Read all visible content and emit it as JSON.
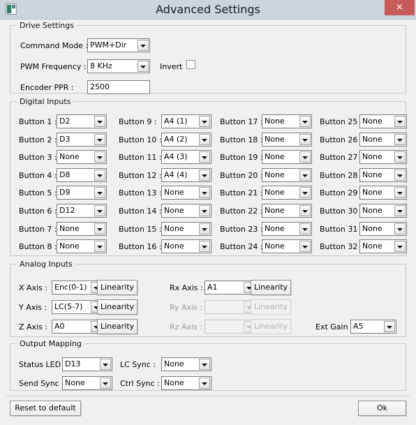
{
  "window": {
    "title": "Advanced Settings",
    "icon": "app-icon",
    "close_label": "×"
  },
  "drive_settings": {
    "legend": "Drive Settings",
    "fields": [
      {
        "label": "Command Mode :",
        "value": "PWM+Dir"
      },
      {
        "label": "PWM Frequency :",
        "value": "8 KHz"
      },
      {
        "label": "Encoder PPR :",
        "value": "2500"
      }
    ],
    "invert": {
      "label": "Invert",
      "checked": false
    }
  },
  "digital_inputs": {
    "legend": "Digital Inputs",
    "buttons": [
      {
        "label": "Button  1 :",
        "value": "D2"
      },
      {
        "label": "Button  2 :",
        "value": "D3"
      },
      {
        "label": "Button  3 :",
        "value": "None"
      },
      {
        "label": "Button  4 :",
        "value": "D8"
      },
      {
        "label": "Button  5 :",
        "value": "D9"
      },
      {
        "label": "Button  6 :",
        "value": "D12"
      },
      {
        "label": "Button  7 :",
        "value": "None"
      },
      {
        "label": "Button  8 :",
        "value": "None"
      },
      {
        "label": "Button  9 :",
        "value": "A4 (1)"
      },
      {
        "label": "Button 10 :",
        "value": "A4 (2)"
      },
      {
        "label": "Button 11 :",
        "value": "A4 (3)"
      },
      {
        "label": "Button 12 :",
        "value": "A4 (4)"
      },
      {
        "label": "Button 13 :",
        "value": "None"
      },
      {
        "label": "Button 14 :",
        "value": "None"
      },
      {
        "label": "Button 15 :",
        "value": "None"
      },
      {
        "label": "Button 16 :",
        "value": "None"
      },
      {
        "label": "Button 17 :",
        "value": "None"
      },
      {
        "label": "Button 18 :",
        "value": "None"
      },
      {
        "label": "Button 19 :",
        "value": "None"
      },
      {
        "label": "Button 20 :",
        "value": "None"
      },
      {
        "label": "Button 21 :",
        "value": "None"
      },
      {
        "label": "Button 22 :",
        "value": "None"
      },
      {
        "label": "Button 23 :",
        "value": "None"
      },
      {
        "label": "Button 24 :",
        "value": "None"
      },
      {
        "label": "Button 25 :",
        "value": "None"
      },
      {
        "label": "Button 26 :",
        "value": "None"
      },
      {
        "label": "Button 27 :",
        "value": "None"
      },
      {
        "label": "Button 28 :",
        "value": "None"
      },
      {
        "label": "Button 29 :",
        "value": "None"
      },
      {
        "label": "Button 30 :",
        "value": "None"
      },
      {
        "label": "Button 31 :",
        "value": "None"
      },
      {
        "label": "Button 32 :",
        "value": "None"
      }
    ]
  },
  "analog_inputs": {
    "legend": "Analog Inputs",
    "linearity_label": "Linearity",
    "left_axes": [
      {
        "label": "X Axis :",
        "value": "Enc(0-1)",
        "enabled": true
      },
      {
        "label": "Y Axis :",
        "value": "LC(5-7)",
        "enabled": true
      },
      {
        "label": "Z Axis :",
        "value": "A0",
        "enabled": true
      }
    ],
    "right_axes": [
      {
        "label": "Rx Axis :",
        "value": "A1",
        "enabled": true
      },
      {
        "label": "Ry Axis :",
        "value": "",
        "enabled": false
      },
      {
        "label": "Rz Axis :",
        "value": "",
        "enabled": false
      }
    ],
    "ext_gain": {
      "label": "Ext Gain :",
      "value": "A5"
    }
  },
  "output_mapping": {
    "legend": "Output Mapping",
    "fields": [
      {
        "label": "Status LED :",
        "value": "D13"
      },
      {
        "label": "Send Sync :",
        "value": "None"
      },
      {
        "label": "LC Sync :",
        "value": "None"
      },
      {
        "label": "Ctrl Sync :",
        "value": "None"
      }
    ]
  },
  "footer": {
    "reset_label": "Reset to default",
    "ok_label": "Ok"
  },
  "colors": {
    "titlebar": "#cbd5dd",
    "close": "#c75b5b",
    "background": "#f0f0f0",
    "group_border": "#c8c8c8"
  }
}
